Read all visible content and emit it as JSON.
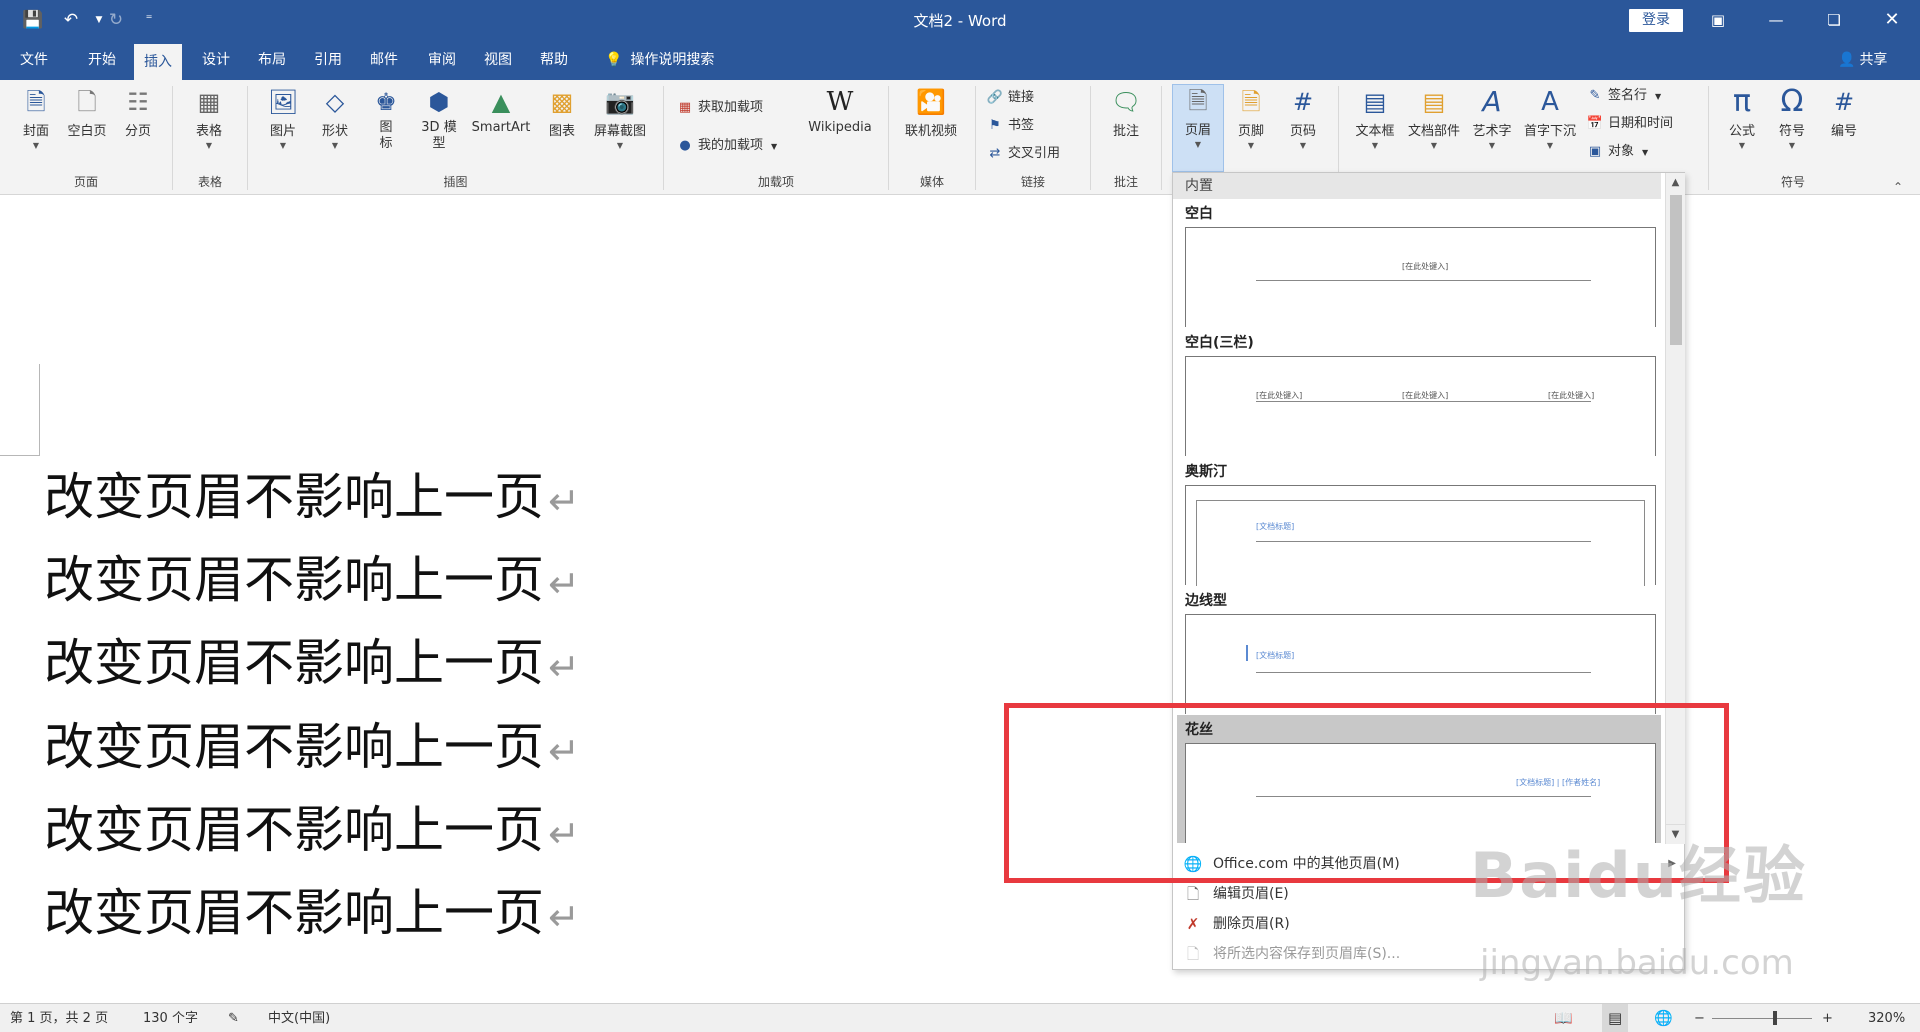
{
  "titlebar": {
    "doc_title": "文档2 - Word",
    "login": "登录",
    "qat_more": "⁼",
    "icons": [
      "save-icon",
      "undo-icon",
      "redo-icon"
    ]
  },
  "tabs": [
    "文件",
    "开始",
    "插入",
    "设计",
    "布局",
    "引用",
    "邮件",
    "审阅",
    "视图",
    "帮助"
  ],
  "active_tab": "插入",
  "search": "操作说明搜索",
  "share": "共享",
  "ribbon": {
    "pages": {
      "cover": "封面",
      "blank": "空白页",
      "break": "分页",
      "group": "页面"
    },
    "tables": {
      "table": "表格",
      "group": "表格"
    },
    "illustrations": {
      "picture": "图片",
      "shapes": "形状",
      "icons": "图标",
      "model3d": "3D 模型",
      "smartart": "SmartArt",
      "chart": "图表",
      "screenshot": "屏幕截图",
      "group": "插图"
    },
    "addins": {
      "get": "获取加载项",
      "my": "我的加载项",
      "wiki": "Wikipedia",
      "group": "加载项"
    },
    "media": {
      "video": "联机视频",
      "group": "媒体"
    },
    "links": {
      "link": "链接",
      "bookmark": "书签",
      "crossref": "交叉引用",
      "group": "链接"
    },
    "comments": {
      "comment": "批注",
      "group": "批注"
    },
    "header_footer": {
      "header": "页眉",
      "footer": "页脚",
      "pagenum": "页码"
    },
    "text": {
      "textbox": "文本框",
      "parts": "文档部件",
      "wordart": "艺术字",
      "dropcap": "首字下沉",
      "signature": "签名行",
      "datetime": "日期和时间",
      "object": "对象"
    },
    "symbols": {
      "equation": "公式",
      "symbol": "符号",
      "number": "编号",
      "group": "符号"
    }
  },
  "document": {
    "lines": [
      "改变页眉不影响上一页",
      "改变页眉不影响上一页",
      "改变页眉不影响上一页",
      "改变页眉不影响上一页",
      "改变页眉不影响上一页",
      "改变页眉不影响上一页"
    ],
    "para_mark": "↵"
  },
  "gallery": {
    "section": "内置",
    "items": [
      {
        "name": "空白",
        "placeholders": [
          "[在此处键入]"
        ]
      },
      {
        "name": "空白(三栏)",
        "placeholders": [
          "[在此处键入]",
          "[在此处键入]",
          "[在此处键入]"
        ]
      },
      {
        "name": "奥斯汀",
        "placeholders": [
          "[文档标题]"
        ]
      },
      {
        "name": "边线型",
        "placeholders": [
          "[文档标题]"
        ]
      },
      {
        "name": "花丝",
        "placeholders": [
          "[文档标题] | [作者姓名]"
        ]
      }
    ],
    "selected": "花丝",
    "commands": [
      {
        "label": "Office.com 中的其他页眉(M)",
        "disabled": false
      },
      {
        "label": "编辑页眉(E)",
        "disabled": false
      },
      {
        "label": "删除页眉(R)",
        "disabled": false
      },
      {
        "label": "将所选内容保存到页眉库(S)...",
        "disabled": true
      }
    ]
  },
  "status": {
    "page": "第 1 页，共 2 页",
    "words": "130 个字",
    "language": "中文(中国)",
    "zoom": "320%",
    "zoom_minus": "−",
    "zoom_plus": "+"
  },
  "watermark": {
    "line1": "Baidu经验",
    "line2": "jingyan.baidu.com"
  },
  "colors": {
    "accent": "#2b579a",
    "highlight": "#e8393f",
    "selected_item": "#c8c8c8"
  }
}
